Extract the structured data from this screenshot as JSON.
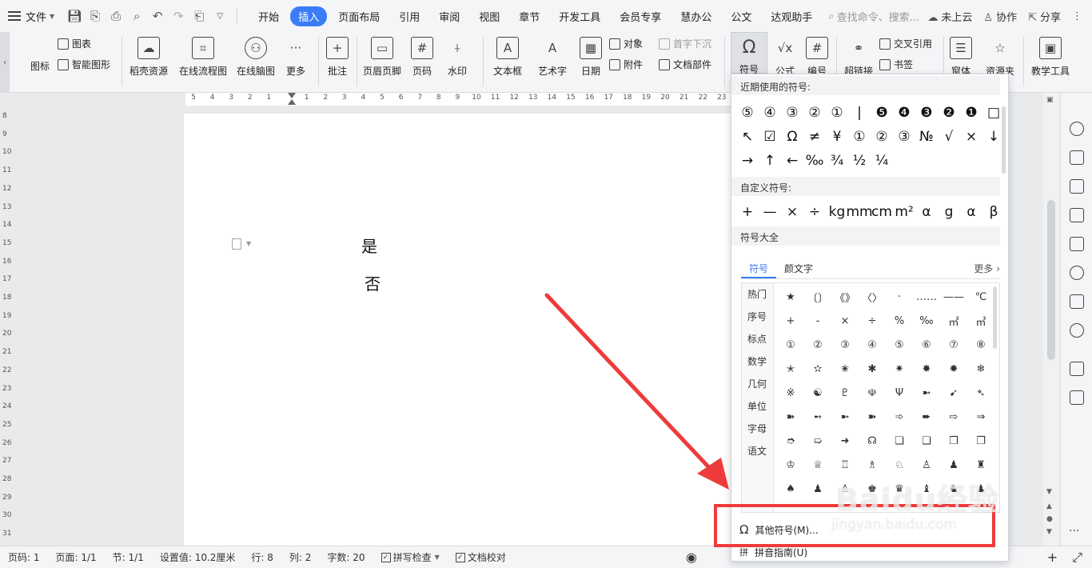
{
  "menubar": {
    "file_label": "文件",
    "tabs": [
      {
        "label": "开始"
      },
      {
        "label": "插入"
      },
      {
        "label": "页面布局"
      },
      {
        "label": "引用"
      },
      {
        "label": "审阅"
      },
      {
        "label": "视图"
      },
      {
        "label": "章节"
      },
      {
        "label": "开发工具"
      },
      {
        "label": "会员专享"
      },
      {
        "label": "慧办公"
      },
      {
        "label": "公文"
      },
      {
        "label": "达观助手"
      }
    ],
    "search_placeholder": "查找命令、搜索...",
    "cloud_label": "未上云",
    "collab_label": "协作",
    "share_label": "分享"
  },
  "ribbon": {
    "icon_label": "图标",
    "chart_label": "图表",
    "smartart_label": "智能图形",
    "docer_label": "稻壳资源",
    "flow_label": "在线流程图",
    "mind_label": "在线脑图",
    "more_label": "更多",
    "comment_label": "批注",
    "header_label": "页眉页脚",
    "pagenum_label": "页码",
    "watermark_label": "水印",
    "textbox_label": "文本框",
    "wordart_label": "艺术字",
    "date_label": "日期",
    "object_label": "对象",
    "dropcap_label": "首字下沉",
    "attach_label": "附件",
    "docpart_label": "文档部件",
    "symbol_label": "符号",
    "formula_label": "公式",
    "numbering_label": "编号",
    "hyperlink_label": "超链接",
    "crossref_label": "交叉引用",
    "bookmark_label": "书签",
    "window_label": "窗体",
    "resource_label": "资源夹",
    "teach_label": "教学工具"
  },
  "ruler": {
    "h_ticks": [
      "5",
      "4",
      "3",
      "2",
      "1",
      "",
      "1",
      "2",
      "3",
      "4",
      "5",
      "6",
      "7",
      "8",
      "9",
      "10",
      "11",
      "12",
      "13",
      "14",
      "15",
      "16",
      "17",
      "18",
      "19",
      "20",
      "21",
      "22",
      "23"
    ],
    "v_ticks": [
      "8",
      "9",
      "10",
      "11",
      "12",
      "13",
      "14",
      "15",
      "16",
      "17",
      "18",
      "19",
      "20",
      "21",
      "22",
      "23",
      "24",
      "25",
      "26",
      "27",
      "28",
      "29",
      "30",
      "31"
    ]
  },
  "document": {
    "line1": "是",
    "line2": "否"
  },
  "symbol_panel": {
    "recent_header": "近期使用的符号:",
    "recent_symbols": [
      "⑤",
      "④",
      "③",
      "②",
      "①",
      "|",
      "❺",
      "❹",
      "❸",
      "❷",
      "❶",
      "□",
      "↖",
      "☑",
      "Ω",
      "≠",
      "¥",
      "①",
      "②",
      "③",
      "№",
      "√",
      "×",
      "↓",
      "→",
      "↑",
      "←",
      "‰",
      "¾",
      "½",
      "¼"
    ],
    "custom_header": "自定义符号:",
    "custom_symbols": [
      "+",
      "—",
      "×",
      "÷",
      "kg",
      "mm",
      "cm",
      "m²",
      "α",
      "g",
      "α",
      "β"
    ],
    "all_header": "符号大全",
    "tabs": [
      "符号",
      "颜文字"
    ],
    "more_label": "更多",
    "categories": [
      "热门",
      "序号",
      "标点",
      "数学",
      "几何",
      "单位",
      "字母",
      "语文"
    ],
    "table_symbols": [
      "★",
      "〔〕",
      "《》",
      "〈〉",
      "·",
      "……",
      "——",
      "℃",
      "+",
      "-",
      "×",
      "÷",
      "%",
      "‰",
      "㎡",
      "㎥",
      "①",
      "②",
      "③",
      "④",
      "⑤",
      "⑥",
      "⑦",
      "⑧",
      "✭",
      "✫",
      "✬",
      "✱",
      "✷",
      "✸",
      "✹",
      "❄",
      "※",
      "☯",
      "♇",
      "☫",
      "Ψ",
      "➼",
      "➹",
      "➴",
      "➽",
      "➻",
      "➼",
      "➽",
      "➾",
      "➨",
      "⇨",
      "⇒",
      "➮",
      "➯",
      "➜",
      "☊",
      "❏",
      "❑",
      "❒",
      "❐",
      "♔",
      "♕",
      "♖",
      "♗",
      "♘",
      "♙",
      "♟",
      "♜",
      "♠",
      "♟",
      "♙",
      "♚",
      "♛",
      "♝",
      "♞",
      "♟"
    ],
    "footer_other": "其他符号(M)...",
    "footer_pinyin": "拼音指南(U)"
  },
  "statusbar": {
    "page_code": "页码: 1",
    "page": "页面: 1/1",
    "section": "节: 1/1",
    "setting": "设置值: 10.2厘米",
    "row": "行: 8",
    "col": "列: 2",
    "wordcount": "字数: 20",
    "spellcheck": "拼写检查",
    "proofread": "文档校对"
  },
  "watermark": {
    "brand": "Baidu经验",
    "url": "jingyan.baidu.com"
  },
  "colors": {
    "accent": "#3a7cf6",
    "annotation_red": "#ee3b3b"
  }
}
